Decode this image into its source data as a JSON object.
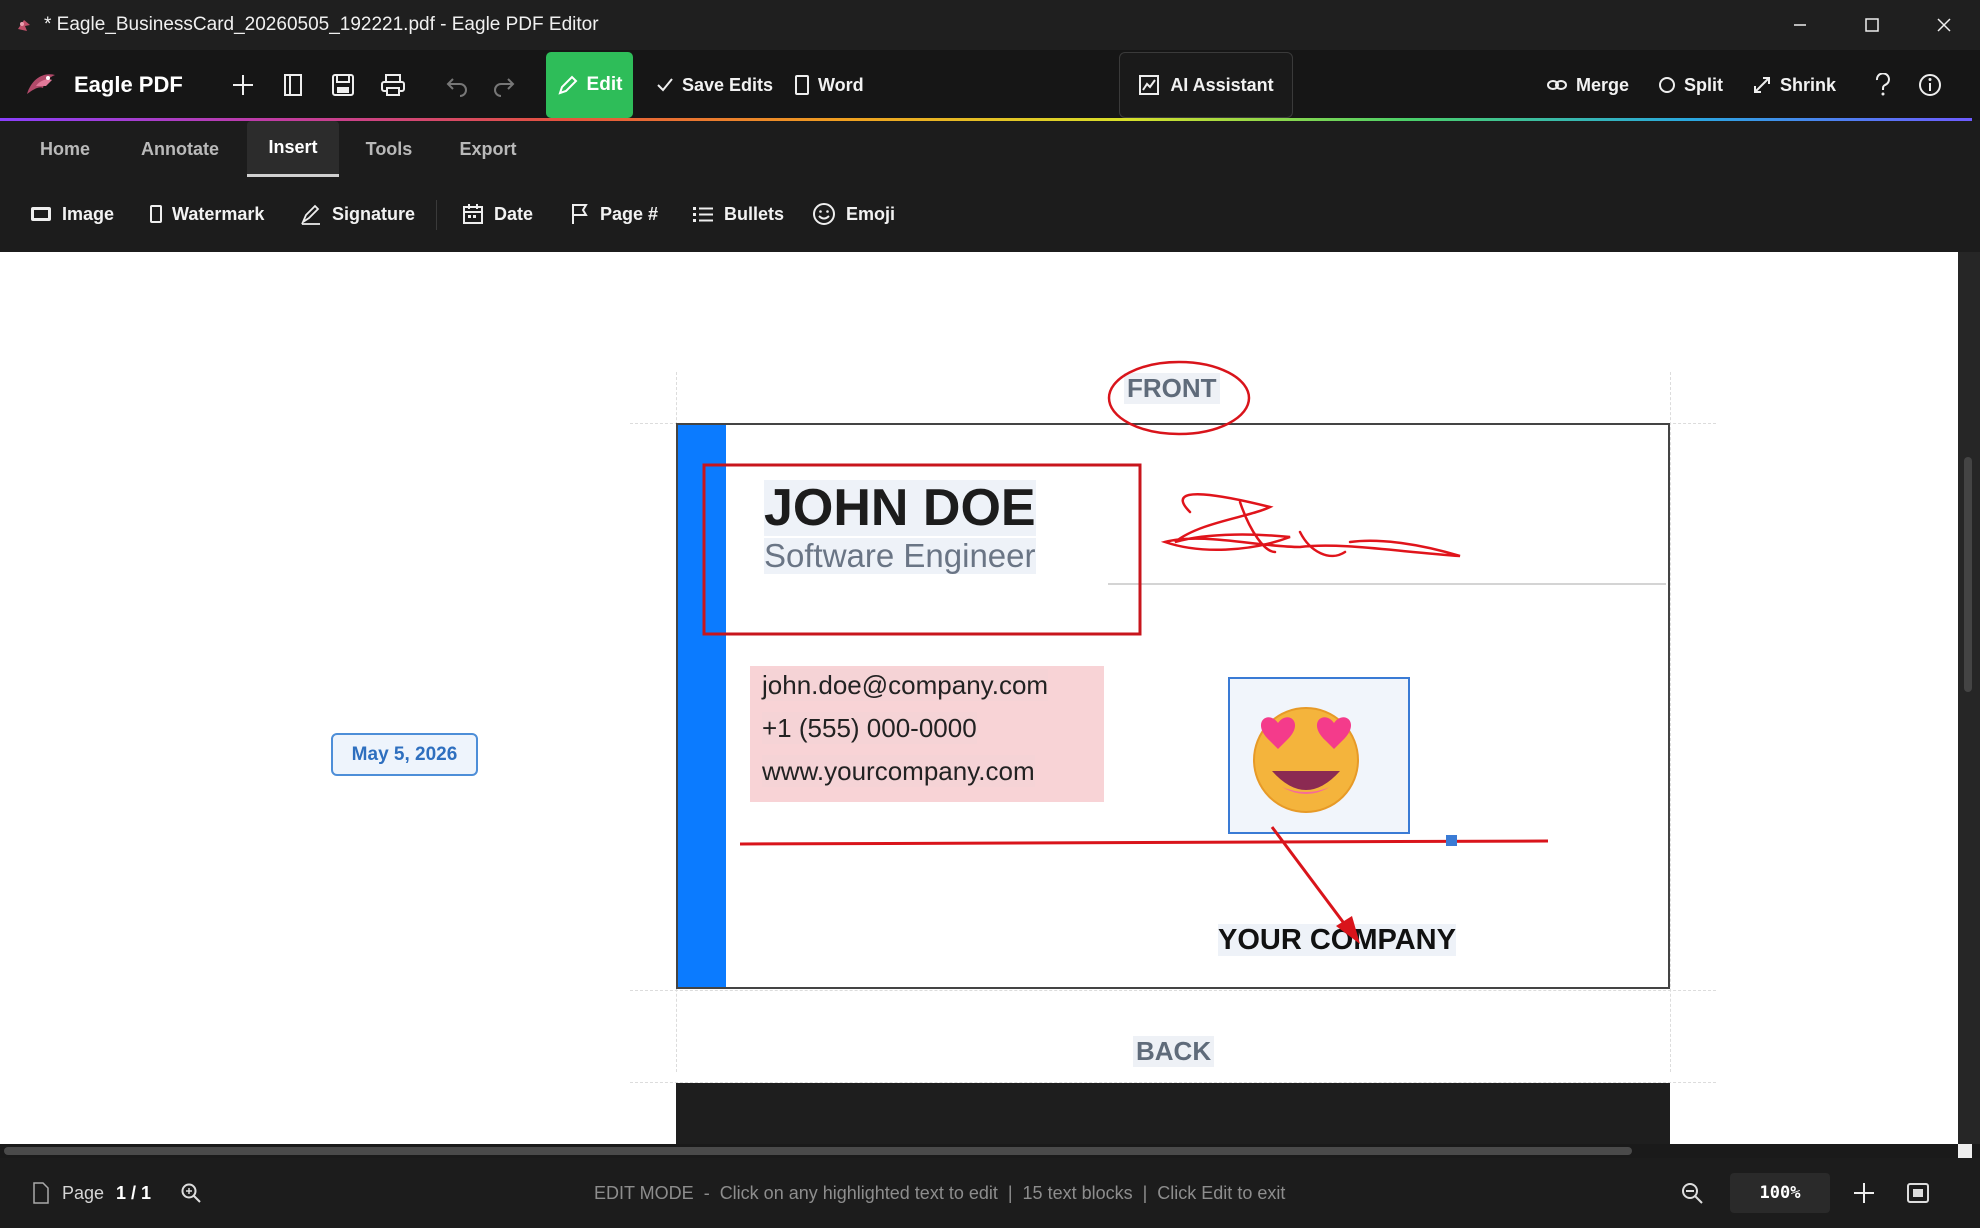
{
  "window": {
    "title": "* Eagle_BusinessCard_20260505_192221.pdf - Eagle PDF Editor"
  },
  "toolbar": {
    "brand": "Eagle PDF",
    "edit_label": "Edit",
    "save_edits_label": "Save Edits",
    "word_label": "Word",
    "ai_label": "AI Assistant",
    "merge_label": "Merge",
    "split_label": "Split",
    "shrink_label": "Shrink"
  },
  "tabs": [
    {
      "label": "Home",
      "active": false
    },
    {
      "label": "Annotate",
      "active": false
    },
    {
      "label": "Insert",
      "active": true
    },
    {
      "label": "Tools",
      "active": false
    },
    {
      "label": "Export",
      "active": false
    }
  ],
  "ribbon": {
    "image": "Image",
    "watermark": "Watermark",
    "signature": "Signature",
    "date": "Date",
    "page_num": "Page #",
    "bullets": "Bullets",
    "emoji": "Emoji"
  },
  "document": {
    "front_label": "FRONT",
    "back_label": "BACK",
    "name": "JOHN DOE",
    "role": "Software Engineer",
    "email": "john.doe@company.com",
    "phone": "+1 (555) 000-0000",
    "website": "www.yourcompany.com",
    "company": "YOUR COMPANY",
    "date_stamp": "May 5, 2026"
  },
  "status": {
    "page_label": "Page",
    "page_value": "1 / 1",
    "mode": "EDIT MODE",
    "hint": "Click on any highlighted text to edit",
    "blocks": "15 text blocks",
    "exit_hint": "Click Edit to exit",
    "sep": "|",
    "dash": "-",
    "zoom": "100%"
  },
  "colors": {
    "accent_green": "#2ebd59",
    "card_blue": "#0b7bff",
    "annotation_red": "#d9141b",
    "highlight_pink": "#f5d3d6"
  }
}
